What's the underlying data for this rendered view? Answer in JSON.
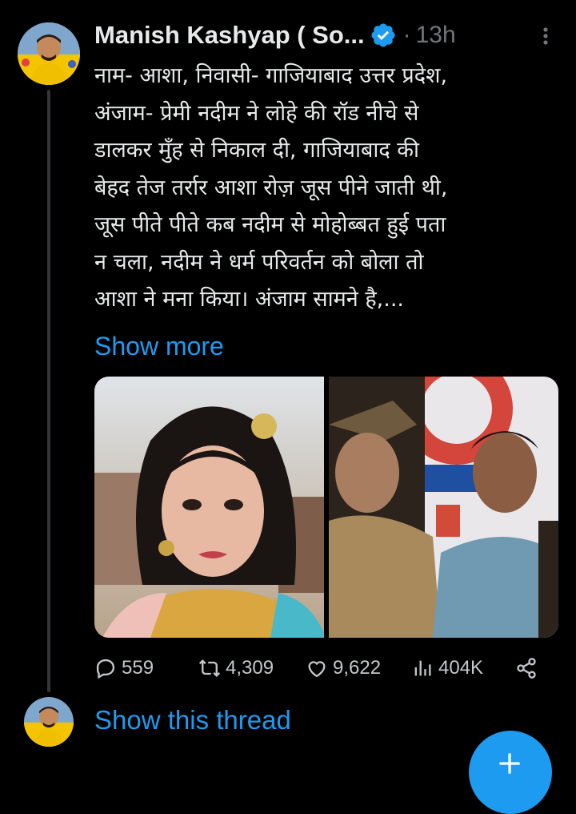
{
  "tweet": {
    "author_name": "Manish Kashyap ( So...",
    "separator": "·",
    "timestamp": "13h",
    "body_lines": [
      "नाम- आशा, निवासी- गाजियाबाद उत्तर प्रदेश,",
      "अंजाम- प्रेमी नदीम ने लोहे की रॉड नीचे से",
      "डालकर मुँह से निकाल दी, गाजियाबाद की",
      "बेहद तेज तर्रार आशा रोज़ जूस पीने जाती थी,",
      "जूस पीते पीते कब नदीम से मोहोब्बत हुई पता",
      "न चला, नदीम ने धर्म परिवर्तन को बोला तो",
      "आशा ने मना किया। अंजाम सामने है,..."
    ],
    "show_more_label": "Show more",
    "media": [
      {
        "icon": "photo-woman-icon"
      },
      {
        "icon": "photo-police-icon"
      }
    ],
    "actions": {
      "replies": "559",
      "retweets": "4,309",
      "likes": "9,622",
      "views": "404K"
    }
  },
  "thread": {
    "show_thread_label": "Show this thread"
  },
  "colors": {
    "background": "#000000",
    "text": "#e7e9ea",
    "muted": "#71767b",
    "accent": "#1d9bf0",
    "thread_line": "#333639"
  }
}
